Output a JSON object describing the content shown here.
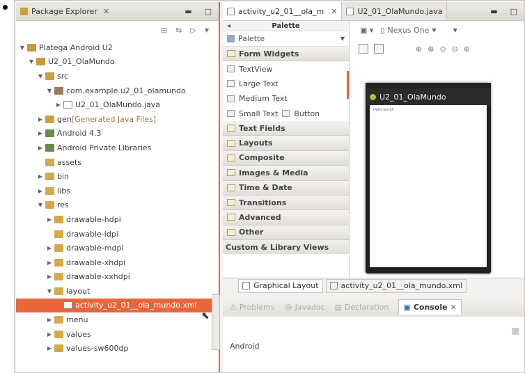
{
  "package_explorer": {
    "title": "Package Explorer",
    "tree": [
      {
        "label": "Platega Android U2",
        "indent": 0,
        "arrow": "open",
        "icon": "proj"
      },
      {
        "label": "U2_01_OlaMundo",
        "indent": 1,
        "arrow": "open",
        "icon": "proj"
      },
      {
        "label": "src",
        "indent": 2,
        "arrow": "open",
        "icon": "src"
      },
      {
        "label": "com.example.u2_01_olamundo",
        "indent": 3,
        "arrow": "open",
        "icon": "pkg"
      },
      {
        "label": "U2_01_OlaMundo.java",
        "indent": 4,
        "arrow": "closed",
        "icon": "file"
      },
      {
        "label": "gen",
        "suffix": " [Generated Java Files]",
        "indent": 2,
        "arrow": "closed",
        "icon": "gen"
      },
      {
        "label": "Android 4.3",
        "indent": 2,
        "arrow": "closed",
        "icon": "lib"
      },
      {
        "label": "Android Private Libraries",
        "indent": 2,
        "arrow": "closed",
        "icon": "lib"
      },
      {
        "label": "assets",
        "indent": 2,
        "arrow": "none",
        "icon": "folder"
      },
      {
        "label": "bin",
        "indent": 2,
        "arrow": "closed",
        "icon": "folder"
      },
      {
        "label": "libs",
        "indent": 2,
        "arrow": "closed",
        "icon": "folder"
      },
      {
        "label": "res",
        "indent": 2,
        "arrow": "open",
        "icon": "folder"
      },
      {
        "label": "drawable-hdpi",
        "indent": 3,
        "arrow": "closed",
        "icon": "folder"
      },
      {
        "label": "drawable-ldpi",
        "indent": 3,
        "arrow": "none",
        "icon": "folder"
      },
      {
        "label": "drawable-mdpi",
        "indent": 3,
        "arrow": "closed",
        "icon": "folder"
      },
      {
        "label": "drawable-xhdpi",
        "indent": 3,
        "arrow": "closed",
        "icon": "folder"
      },
      {
        "label": "drawable-xxhdpi",
        "indent": 3,
        "arrow": "closed",
        "icon": "folder"
      },
      {
        "label": "layout",
        "indent": 3,
        "arrow": "open",
        "icon": "folder"
      },
      {
        "label": "activity_u2_01__ola_mundo.xml",
        "indent": 4,
        "arrow": "none",
        "icon": "file",
        "selected": true
      },
      {
        "label": "menu",
        "indent": 3,
        "arrow": "closed",
        "icon": "folder"
      },
      {
        "label": "values",
        "indent": 3,
        "arrow": "closed",
        "icon": "folder"
      },
      {
        "label": "values-sw600dp",
        "indent": 3,
        "arrow": "closed",
        "icon": "folder"
      }
    ]
  },
  "editor": {
    "tabs": [
      {
        "label": "activity_u2_01__ola_m",
        "active": true
      },
      {
        "label": "U2_01_OlaMundo.java",
        "active": false
      }
    ],
    "palette": {
      "header": "Palette",
      "selector": "Palette",
      "groups": [
        {
          "label": "Form Widgets",
          "type": "group"
        },
        {
          "label": "TextView",
          "type": "item"
        },
        {
          "label": "Large Text",
          "type": "item"
        },
        {
          "label": "Medium Text",
          "type": "item"
        },
        {
          "label": "Small Text",
          "type": "item",
          "extra": "Button"
        },
        {
          "label": "Text Fields",
          "type": "group"
        },
        {
          "label": "Layouts",
          "type": "group"
        },
        {
          "label": "Composite",
          "type": "group"
        },
        {
          "label": "Images & Media",
          "type": "group"
        },
        {
          "label": "Time & Date",
          "type": "group"
        },
        {
          "label": "Transitions",
          "type": "group"
        },
        {
          "label": "Advanced",
          "type": "group"
        },
        {
          "label": "Other",
          "type": "group"
        }
      ],
      "custom": "Custom & Library Views"
    },
    "device_selector": "Nexus One",
    "device": {
      "app_title": "U2_01_OlaMundo",
      "hello": "Hello world!"
    },
    "bottom_tabs": [
      {
        "label": "Graphical Layout",
        "active": true
      },
      {
        "label": "activity_u2_01__ola_mundo.xml",
        "active": false
      }
    ]
  },
  "console": {
    "tabs": [
      {
        "label": "Problems",
        "active": false
      },
      {
        "label": "Javadoc",
        "active": false
      },
      {
        "label": "Declaration",
        "active": false
      },
      {
        "label": "Console",
        "active": true
      }
    ],
    "content": "Android"
  },
  "colors": {
    "selection": "#e8663a",
    "folder": "#d4a94c",
    "android_green": "#a4c639"
  }
}
